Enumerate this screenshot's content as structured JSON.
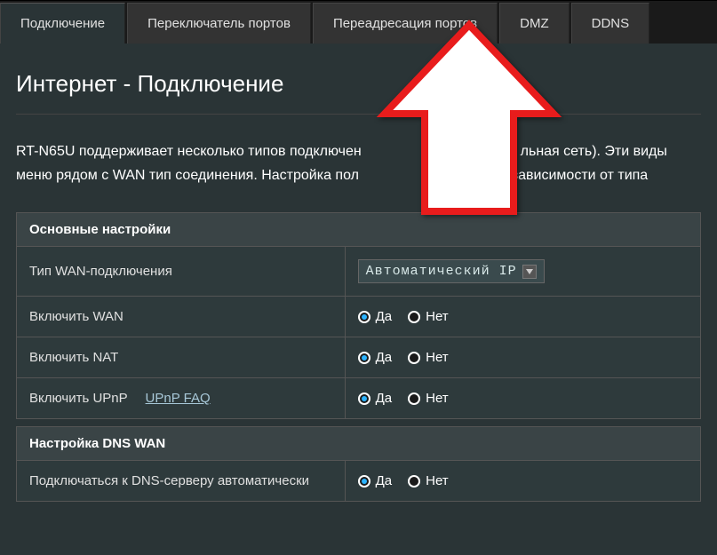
{
  "tabs": [
    {
      "label": "Подключение",
      "active": true
    },
    {
      "label": "Переключатель портов",
      "active": false
    },
    {
      "label": "Переадресация портов",
      "active": false
    },
    {
      "label": "DMZ",
      "active": false
    },
    {
      "label": "DDNS",
      "active": false
    }
  ],
  "page_title": "Интернет - Подключение",
  "description_before": "RT-N65U поддерживает несколько типов подключен",
  "description_mid": "льная сеть). Эти виды",
  "description_line2_before": "меню рядом с WAN тип соединения. Настройка пол",
  "description_line2_after": "в зависимости от типа",
  "sections": {
    "basic": {
      "header": "Основные настройки",
      "rows": {
        "wan_type": {
          "label": "Тип WAN-подключения",
          "value": "Автоматический IP"
        },
        "enable_wan": {
          "label": "Включить WAN",
          "yes": "Да",
          "no": "Нет"
        },
        "enable_nat": {
          "label": "Включить NAT",
          "yes": "Да",
          "no": "Нет"
        },
        "enable_upnp": {
          "label": "Включить UPnP",
          "faq": "UPnP  FAQ",
          "yes": "Да",
          "no": "Нет"
        }
      }
    },
    "dns": {
      "header": "Настройка DNS WAN",
      "rows": {
        "auto_dns": {
          "label": "Подключаться к DNS-серверу автоматически",
          "yes": "Да",
          "no": "Нет"
        }
      }
    }
  }
}
